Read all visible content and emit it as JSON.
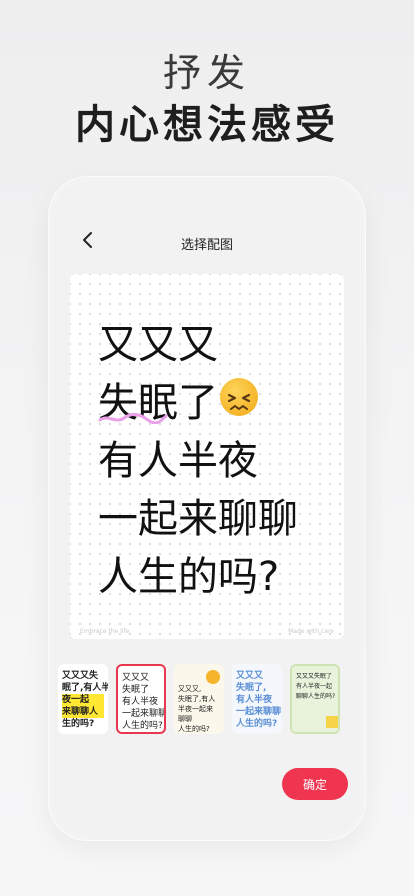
{
  "headline": {
    "line1": "抒发",
    "line2": "内心想法感受"
  },
  "nav": {
    "title": "选择配图"
  },
  "preview": {
    "lines": [
      "又又又",
      "失眠了",
      "有人半夜",
      "一起来聊聊",
      "人生的吗?"
    ],
    "footer_left": "Embrace the life",
    "footer_right": "Made with care",
    "accent_color": "#e9a0e8"
  },
  "thumbnails": [
    {
      "lines": [
        "又又又失",
        "眠了,有人半",
        "夜一起",
        "来聊聊人",
        "生的吗?"
      ]
    },
    {
      "lines": [
        "又又又",
        "失眠了",
        "有人半夜",
        "一起来聊聊",
        "人生的吗?"
      ],
      "selected": true
    },
    {
      "lines": [
        "又又又,",
        "失眠了,有人",
        "半夜一起来",
        "聊聊",
        "人生的吗?"
      ]
    },
    {
      "lines": [
        "又又又",
        "失眠了,",
        "有人半夜",
        "一起来聊聊",
        "人生的吗?"
      ]
    },
    {
      "lines": [
        "又又又失眠了",
        "有人半夜一起",
        "聊聊人生的吗?"
      ]
    }
  ],
  "actions": {
    "confirm_label": "确定"
  },
  "colors": {
    "confirm": "#ef3550",
    "selected_border": "#e8374e"
  }
}
